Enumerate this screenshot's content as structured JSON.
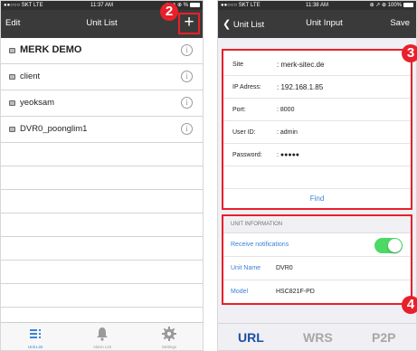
{
  "left_screen": {
    "status": {
      "carrier": "●●○○○ SKT LTE",
      "time": "11:37 AM",
      "indicators": "⊕ ↗ ⊕ %"
    },
    "nav": {
      "left": "Edit",
      "title": "Unit List",
      "add": "+"
    },
    "callout": "2",
    "units": [
      {
        "label": "MERK DEMO"
      },
      {
        "label": "client"
      },
      {
        "label": "yeoksam"
      },
      {
        "label": "DVR0_poonglim1"
      }
    ],
    "tabs": [
      {
        "label": "Unit List",
        "icon": "list-icon"
      },
      {
        "label": "Alarm List",
        "icon": "bell-icon"
      },
      {
        "label": "Settings",
        "icon": "gear-icon"
      }
    ]
  },
  "right_screen": {
    "status": {
      "carrier": "●●○○○ SKT LTE",
      "time": "11:38 AM",
      "indicators": "⊕ ↗ ⊕ 100%"
    },
    "nav": {
      "back": "Unit List",
      "title": "Unit Input",
      "save": "Save"
    },
    "callout_top": "3",
    "callout_bottom": "4",
    "form": {
      "site_label": "Site",
      "site_value": ": merk-sitec.de",
      "ip_label": "IP Adress:",
      "ip_value": ": 192.168.1.85",
      "port_label": "Port:",
      "port_value": ": 8000",
      "user_label": "User ID:",
      "user_value": ": admin",
      "password_label": "Password:",
      "password_value": ": ●●●●●",
      "find_label": "Find"
    },
    "unit_info": {
      "header": "UNIT INFORMATION",
      "notifications_label": "Receive notifications",
      "notifications_on": true,
      "unit_name_label": "Unit Name",
      "unit_name_value": "DVR0",
      "model_label": "Model",
      "model_value": "HSC821F-PD"
    },
    "protocols": [
      {
        "label": "URL",
        "active": true
      },
      {
        "label": "WRS",
        "active": false
      },
      {
        "label": "P2P",
        "active": false
      }
    ]
  },
  "colors": {
    "accent": "#3b82d6",
    "callout": "#e8202a",
    "toggle_on": "#4cd964",
    "nav_bg": "#3a3a3a"
  }
}
